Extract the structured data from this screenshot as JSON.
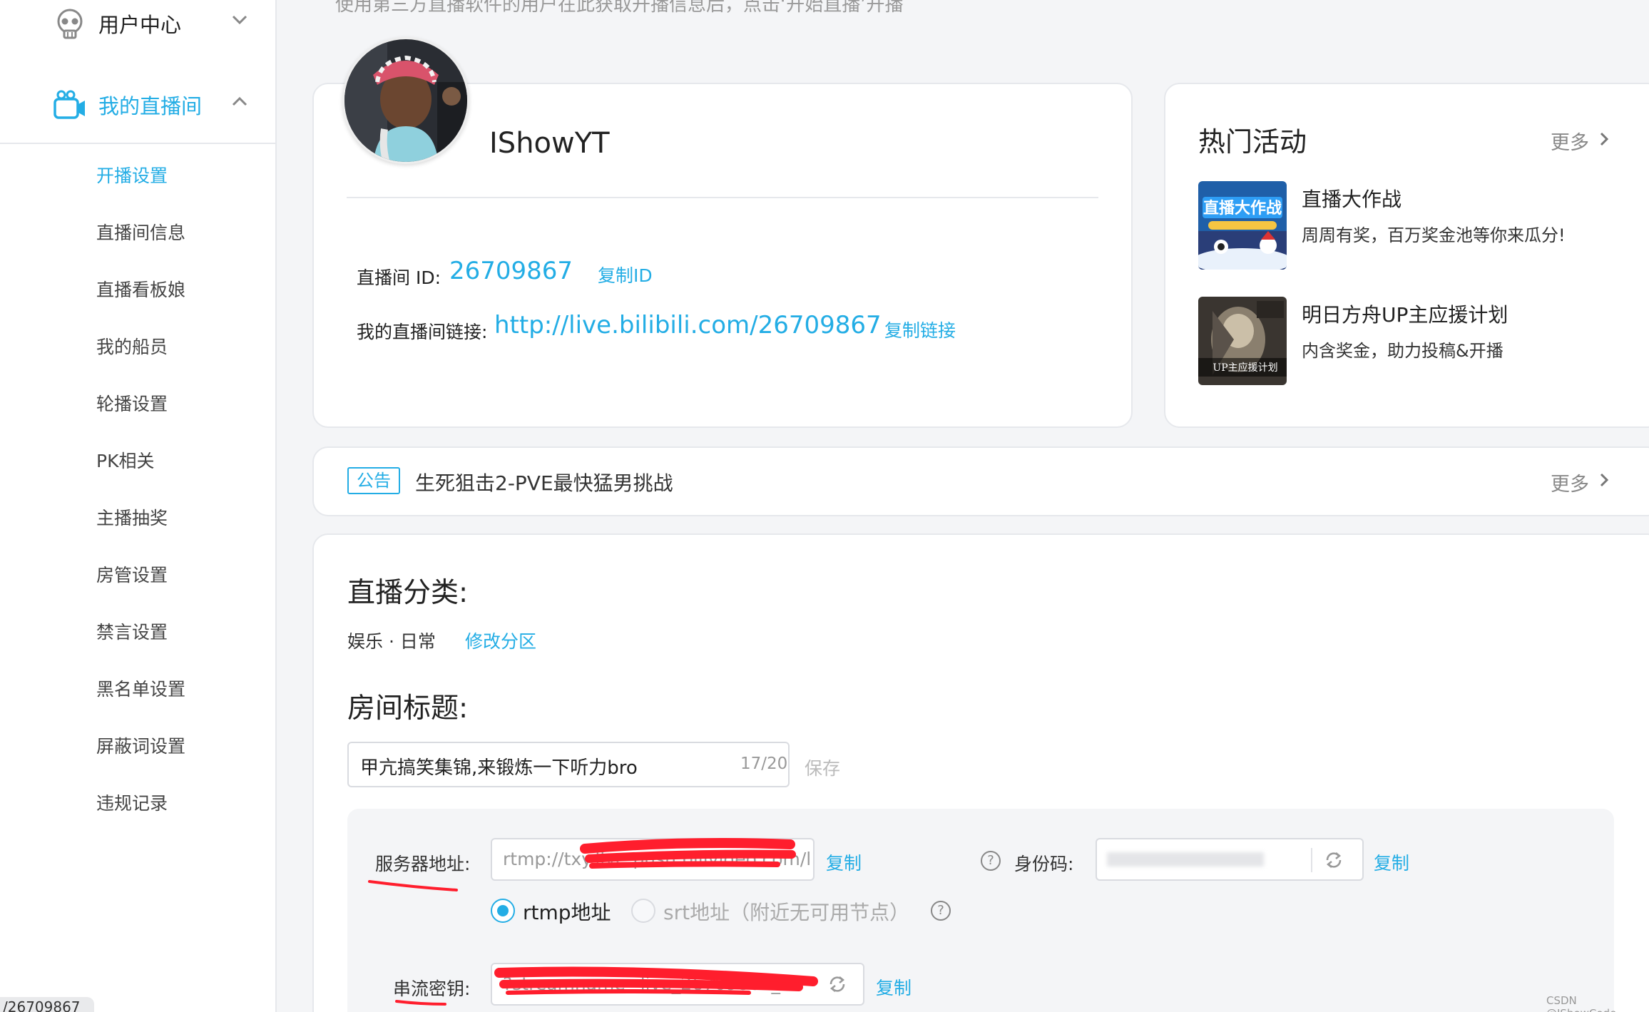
{
  "top_strip": "使用第三方直播软件的用户在此获取开播信息后，点击‘开始直播’开播",
  "sidebar": {
    "groups": [
      {
        "label": "用户中心",
        "icon": "skull-icon"
      },
      {
        "label": "我的直播间",
        "icon": "camera-icon"
      }
    ],
    "items": [
      "开播设置",
      "直播间信息",
      "直播看板娘",
      "我的船员",
      "轮播设置",
      "PK相关",
      "主播抽奖",
      "房管设置",
      "禁言设置",
      "黑名单设置",
      "屏蔽词设置",
      "违规记录"
    ],
    "active_item": "开播设置",
    "url_pill": "/26709867"
  },
  "profile": {
    "username": "IShowYT",
    "room_id_label": "直播间 ID:",
    "room_id": "26709867",
    "copy_id": "复制ID",
    "link_label": "我的直播间链接:",
    "link": "http://live.bilibili.com/26709867",
    "copy_link": "复制链接"
  },
  "activities": {
    "title": "热门活动",
    "more": "更多",
    "items": [
      {
        "name": "直播大作战",
        "desc": "周周有奖，百万奖金池等你来瓜分!",
        "thumb_text": "直播大作战"
      },
      {
        "name": "明日方舟UP主应援计划",
        "desc": "内含奖金，助力投稿&开播",
        "thumb_text": "UP主应援计划"
      }
    ]
  },
  "notice": {
    "tag": "公告",
    "text": "生死狙击2-PVE最快猛男挑战",
    "more": "更多"
  },
  "settings": {
    "category_title": "直播分类:",
    "category_value": "娱乐 · 日常",
    "change_category": "修改分区",
    "room_title_label": "房间标题:",
    "room_title_value": "甲亢搞笑集锦,来锻炼一下听力bro",
    "room_title_count": "17/20",
    "save": "保存"
  },
  "stream": {
    "server_label": "服务器地址:",
    "server_value": "rtmp://txy.live-push.bilivideo.com/live-bvc/",
    "copy": "复制",
    "id_code_label": "身份码:",
    "id_code_copy": "复制",
    "rtmp_option": "rtmp地址",
    "srt_option": "srt地址（附近无可用节点）",
    "key_label": "串流密钥:",
    "key_value": "?streamname=live_26709867_",
    "key_copy": "复制"
  },
  "colors": {
    "accent": "#23ade5",
    "redaction": "#ff1e2d"
  },
  "watermark": "CSDN @IShowCode"
}
